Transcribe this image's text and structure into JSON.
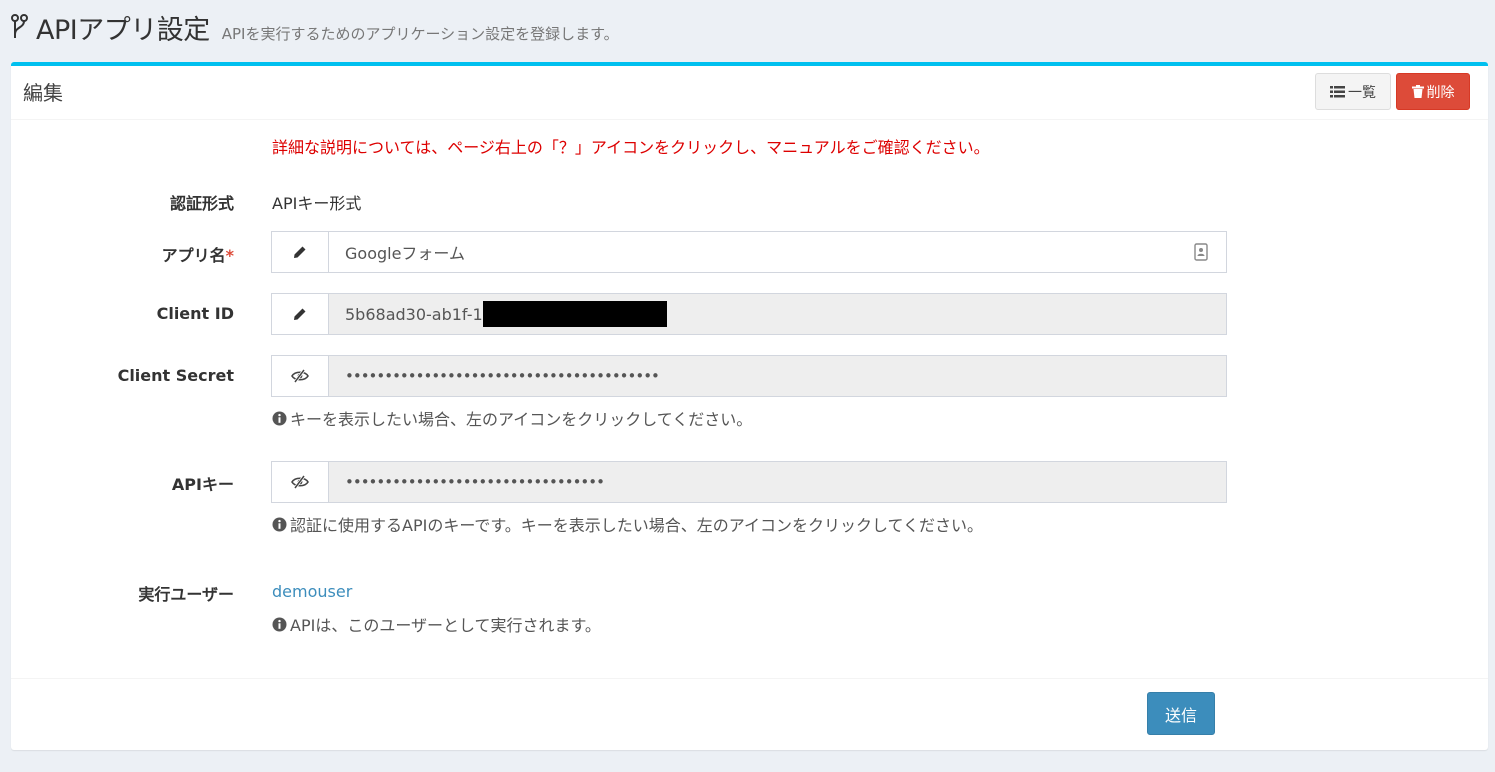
{
  "header": {
    "title": "APIアプリ設定",
    "subtitle": "APIを実行するためのアプリケーション設定を登録します。"
  },
  "box": {
    "title": "編集",
    "list_button": "一覧",
    "delete_button": "削除"
  },
  "notice": "詳細な説明については、ページ右上の「？」アイコンをクリックし、マニュアルをご確認ください。",
  "form": {
    "auth_type": {
      "label": "認証形式",
      "value": "APIキー形式"
    },
    "app_name": {
      "label": "アプリ名",
      "required_mark": "*",
      "value": "Googleフォーム"
    },
    "client_id": {
      "label": "Client ID",
      "value": "5b68ad30-ab1f-1"
    },
    "client_secret": {
      "label": "Client Secret",
      "value": "••••••••••••••••••••••••••••••••••••••••",
      "help": "キーを表示したい場合、左のアイコンをクリックしてください。"
    },
    "api_key": {
      "label": "APIキー",
      "value": "•••••••••••••••••••••••••••••••••",
      "help": "認証に使用するAPIのキーです。キーを表示したい場合、左のアイコンをクリックしてください。"
    },
    "exec_user": {
      "label": "実行ユーザー",
      "value": "demouser",
      "help": "APIは、このユーザーとして実行されます。"
    }
  },
  "footer": {
    "submit_button": "送信"
  },
  "icons": {
    "header": "fork-icon",
    "list": "list-icon",
    "delete": "trash-icon",
    "edit": "pencil-icon",
    "contact": "contact-card-icon",
    "toggle_visibility": "eye-slash-icon",
    "info": "info-circle-icon"
  },
  "colors": {
    "accent_border": "#00c0ef",
    "danger": "#dd4b39",
    "primary": "#3c8dbc",
    "notice_text": "#dd0000",
    "readonly_bg": "#eeeeee"
  }
}
